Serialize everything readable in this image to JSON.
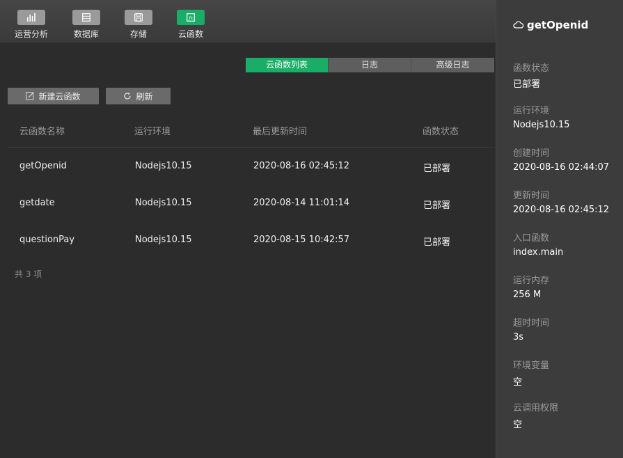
{
  "toolbar": {
    "items": [
      {
        "label": "运营分析",
        "icon": "bar-chart-icon"
      },
      {
        "label": "数据库",
        "icon": "database-icon"
      },
      {
        "label": "存储",
        "icon": "storage-icon"
      },
      {
        "label": "云函数",
        "icon": "function-icon"
      }
    ],
    "active_color": "#1aad67"
  },
  "tabs": [
    {
      "label": "云函数列表",
      "active": true
    },
    {
      "label": "日志",
      "active": false
    },
    {
      "label": "高级日志",
      "active": false
    }
  ],
  "actions": {
    "new_label": "新建云函数",
    "refresh_label": "刷新"
  },
  "table": {
    "columns": [
      "云函数名称",
      "运行环境",
      "最后更新时间",
      "函数状态"
    ],
    "rows": [
      [
        "getOpenid",
        "Nodejs10.15",
        "2020-08-16 02:45:12",
        "已部署"
      ],
      [
        "getdate",
        "Nodejs10.15",
        "2020-08-14 11:01:14",
        "已部署"
      ],
      [
        "questionPay",
        "Nodejs10.15",
        "2020-08-15 10:42:57",
        "已部署"
      ]
    ],
    "count_text": "共 3 项"
  },
  "detail": {
    "title": "getOpenid",
    "title_icon": "cloud-icon",
    "props": [
      {
        "label": "函数状态",
        "value": "已部署"
      },
      {
        "label": "运行环境",
        "value": "Nodejs10.15"
      },
      {
        "label": "创建时间",
        "value": "2020-08-16 02:44:07"
      },
      {
        "label": "更新时间",
        "value": "2020-08-16 02:45:12"
      },
      {
        "label": "入口函数",
        "value": "index.main"
      },
      {
        "label": "运行内存",
        "value": "256 M"
      },
      {
        "label": "超时时间",
        "value": "3s"
      },
      {
        "label": "环境变量",
        "value": "空"
      },
      {
        "label": "云调用权限",
        "value": "空"
      }
    ]
  }
}
